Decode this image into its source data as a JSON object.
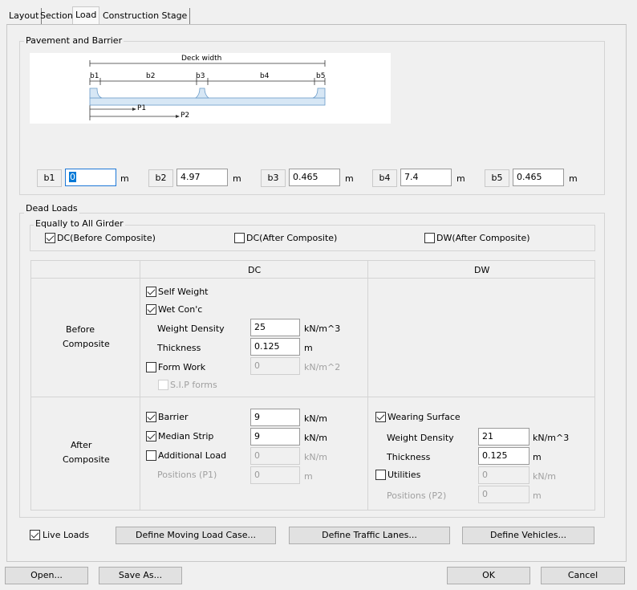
{
  "tabs": [
    "Layout",
    "Section",
    "Load",
    "Construction Stage"
  ],
  "pavement": {
    "title": "Pavement and Barrier",
    "diagram": {
      "deck_width": "Deck width",
      "b1": "b1",
      "b2": "b2",
      "b3": "b3",
      "b4": "b4",
      "b5": "b5",
      "p1": "P1",
      "p2": "P2"
    },
    "fields": [
      {
        "label": "b1",
        "value": "0",
        "unit": "m"
      },
      {
        "label": "b2",
        "value": "4.97",
        "unit": "m"
      },
      {
        "label": "b3",
        "value": "0.465",
        "unit": "m"
      },
      {
        "label": "b4",
        "value": "7.4",
        "unit": "m"
      },
      {
        "label": "b5",
        "value": "0.465",
        "unit": "m"
      }
    ]
  },
  "dead_loads": {
    "title": "Dead Loads",
    "equally_title": "Equally to All Girder",
    "dc_before": {
      "label": "DC(Before Composite)",
      "checked": true
    },
    "dc_after": {
      "label": "DC(After Composite)",
      "checked": false
    },
    "dw_after": {
      "label": "DW(After Composite)",
      "checked": false
    },
    "col_dc": "DC",
    "col_dw": "DW",
    "before_label_1": "Before",
    "before_label_2": "Composite",
    "after_label_1": "After",
    "after_label_2": "Composite",
    "self_weight": "Self Weight",
    "wet_conc": "Wet Con'c",
    "weight_density": {
      "label": "Weight Density",
      "value": "25",
      "unit": "kN/m^3"
    },
    "thickness": {
      "label": "Thickness",
      "value": "0.125",
      "unit": "m"
    },
    "form_work": {
      "label": "Form Work",
      "value": "0",
      "unit": "kN/m^2"
    },
    "sip_forms": "S.I.P forms",
    "barrier": {
      "label": "Barrier",
      "value": "9",
      "unit": "kN/m"
    },
    "median_strip": {
      "label": "Median Strip",
      "value": "9",
      "unit": "kN/m"
    },
    "additional_load": {
      "label": "Additional Load",
      "value": "0",
      "unit": "kN/m"
    },
    "positions_p1": {
      "label": "Positions (P1)",
      "value": "0",
      "unit": "m"
    },
    "wearing_surface": "Wearing Surface",
    "ws_weight_density": {
      "label": "Weight Density",
      "value": "21",
      "unit": "kN/m^3"
    },
    "ws_thickness": {
      "label": "Thickness",
      "value": "0.125",
      "unit": "m"
    },
    "utilities": {
      "label": "Utilities",
      "value": "0",
      "unit": "kN/m"
    },
    "positions_p2": {
      "label": "Positions (P2)",
      "value": "0",
      "unit": "m"
    }
  },
  "live_loads": "Live Loads",
  "buttons": {
    "moving_load": "Define Moving Load Case...",
    "traffic_lanes": "Define Traffic Lanes...",
    "vehicles": "Define Vehicles...",
    "open": "Open...",
    "save_as": "Save As...",
    "ok": "OK",
    "cancel": "Cancel"
  }
}
